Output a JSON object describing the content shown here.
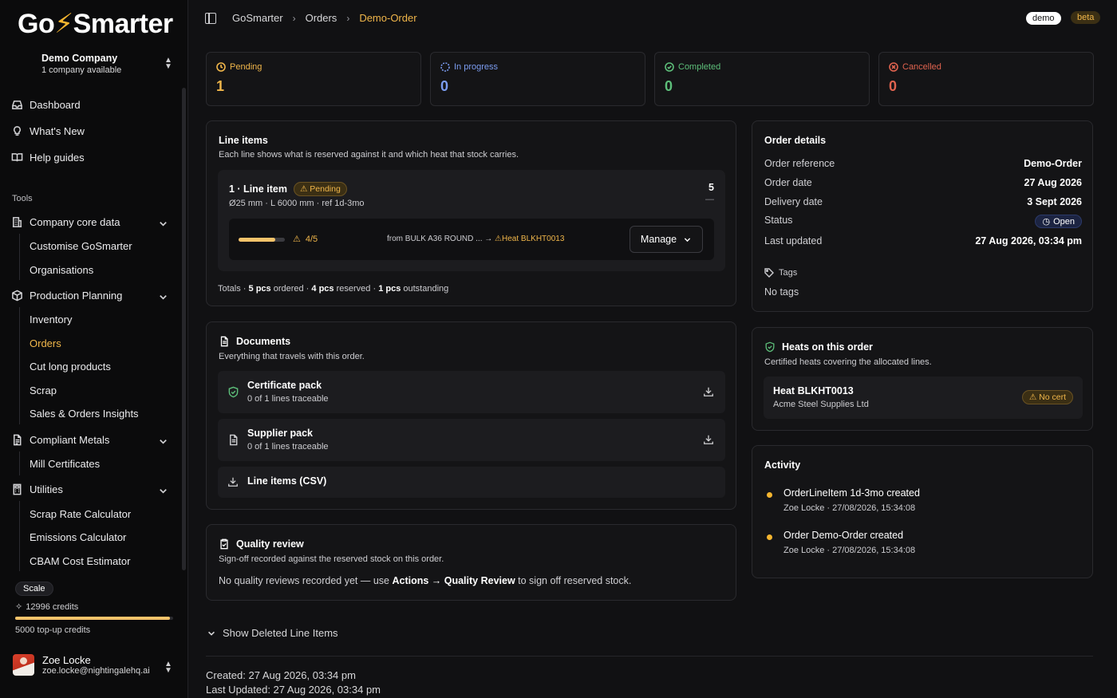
{
  "sidebar": {
    "logo_left": "Go",
    "logo_right": "Smarter",
    "company_name": "Demo Company",
    "company_sub": "1 company available",
    "nav": {
      "dashboard": "Dashboard",
      "whats_new": "What's New",
      "help": "Help guides"
    },
    "tools_label": "Tools",
    "groups": {
      "company_core": "Company core data",
      "customise": "Customise GoSmarter",
      "organisations": "Organisations",
      "production": "Production Planning",
      "inventory": "Inventory",
      "orders": "Orders",
      "cut_long": "Cut long products",
      "scrap": "Scrap",
      "sales_insights": "Sales & Orders Insights",
      "compliant": "Compliant Metals",
      "mill_certs": "Mill Certificates",
      "utilities": "Utilities",
      "scrap_rate": "Scrap Rate Calculator",
      "emissions": "Emissions Calculator",
      "cbam": "CBAM Cost Estimator"
    },
    "plan": "Scale",
    "credits": "12996 credits",
    "credits_fill": 0.98,
    "topup": "5000 top-up credits",
    "user_name": "Zoe Locke",
    "user_email": "zoe.locke@nightingalehq.ai"
  },
  "topbar": {
    "crumbs": [
      "GoSmarter",
      "Orders",
      "Demo-Order"
    ],
    "demo": "demo",
    "beta": "beta"
  },
  "stats": [
    {
      "label": "Pending",
      "value": "1",
      "color": "#f0b64a"
    },
    {
      "label": "In progress",
      "value": "0",
      "color": "#7b9cf0"
    },
    {
      "label": "Completed",
      "value": "0",
      "color": "#5dbf7a"
    },
    {
      "label": "Cancelled",
      "value": "0",
      "color": "#e0634f"
    }
  ],
  "line_items": {
    "title": "Line items",
    "sub": "Each line shows what is reserved against it and which heat that stock carries.",
    "item_title": "1 · Line item",
    "item_status": "Pending",
    "item_meta": "Ø25 mm · L 6000 mm · ref 1d-3mo",
    "item_qty": "5",
    "item_dash": "—",
    "alloc_fill": 0.8,
    "alloc_qty": "4/5",
    "alloc_from": "from BULK A36 ROUND ... →",
    "alloc_heat": "Heat BLKHT0013",
    "manage": "Manage",
    "totals_prefix": "Totals · ",
    "totals_ordered_n": "5 pcs",
    "totals_ordered": " ordered · ",
    "totals_reserved_n": "4 pcs",
    "totals_reserved": " reserved · ",
    "totals_out_n": "1 pcs",
    "totals_out": " outstanding"
  },
  "order_details": {
    "title": "Order details",
    "rows": [
      {
        "k": "Order reference",
        "v": "Demo-Order"
      },
      {
        "k": "Order date",
        "v": "27 Aug 2026"
      },
      {
        "k": "Delivery date",
        "v": "3 Sept 2026"
      },
      {
        "k": "Status",
        "v": "Open"
      },
      {
        "k": "Last updated",
        "v": "27 Aug 2026, 03:34 pm"
      }
    ],
    "tags_label": "Tags",
    "tags_value": "No tags"
  },
  "documents": {
    "title": "Documents",
    "sub": "Everything that travels with this order.",
    "items": [
      {
        "title": "Certificate pack",
        "sub": "0 of 1 lines traceable"
      },
      {
        "title": "Supplier pack",
        "sub": "0 of 1 lines traceable"
      },
      {
        "title": "Line items (CSV)"
      }
    ]
  },
  "heats": {
    "title": "Heats on this order",
    "sub": "Certified heats covering the allocated lines.",
    "heat_name": "Heat BLKHT0013",
    "heat_supplier": "Acme Steel Supplies Ltd",
    "cert": "No cert"
  },
  "quality": {
    "title": "Quality review",
    "sub": "Sign-off recorded against the reserved stock on this order.",
    "msg_a": "No quality reviews recorded yet — use ",
    "msg_b": "Actions → Quality Review",
    "msg_c": " to sign off reserved stock."
  },
  "activity": {
    "title": "Activity",
    "items": [
      {
        "title": "OrderLineItem 1d-3mo created",
        "sub": "Zoe Locke · 27/08/2026, 15:34:08"
      },
      {
        "title": "Order Demo-Order created",
        "sub": "Zoe Locke · 27/08/2026, 15:34:08"
      }
    ]
  },
  "footer": {
    "show_deleted": "Show Deleted Line Items",
    "created": "Created: 27 Aug 2026, 03:34 pm",
    "updated": "Last Updated: 27 Aug 2026, 03:34 pm"
  }
}
